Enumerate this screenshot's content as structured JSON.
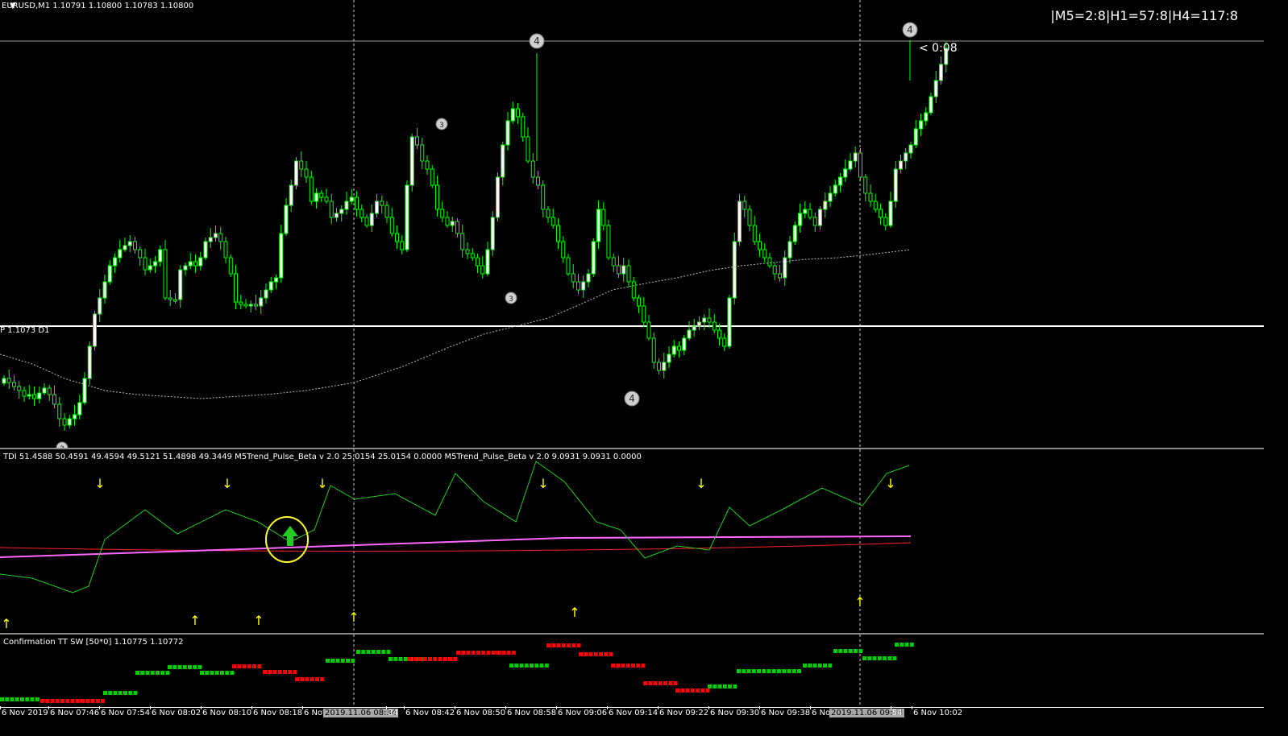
{
  "main": {
    "title": "EURUSD,M1  1.10791 1.10800 1.10783 1.10800",
    "corner_info": "|M5=2:8|H1=57:8|H4=117:8",
    "timer": "< 0:08",
    "pivot_label": "P 1.1073 D1",
    "wave_labels": [
      "4",
      "4",
      "4",
      "3",
      "3",
      "3"
    ]
  },
  "tdi": {
    "title": "TDI 51.4588 50.4591 49.4594 49.5121 51.4898 49.3449  M5Trend_Pulse_Beta v 2.0 25.0154 25.0154 0.0000  M5Trend_Pulse_Beta v 2.0 9.0931 9.0931 0.0000"
  },
  "confirmation": {
    "title": "Confirmation TT SW [50*0] 1.10775 1.10772"
  },
  "xaxis": {
    "ticks": [
      "6 Nov 2019",
      "6 Nov 07:46",
      "6 Nov 07:54",
      "6 Nov 08:02",
      "6 Nov 08:10",
      "6 Nov 08:18",
      "6 Nov",
      "34",
      "6 Nov 08:42",
      "6 Nov 08:50",
      "6 Nov 08:58",
      "6 Nov 09:06",
      "6 Nov 09:14",
      "6 Nov 09:22",
      "6 Nov 09:30",
      "6 Nov 09:38",
      "6 Nov",
      "54",
      "6 Nov 10:02"
    ],
    "highlight_1": "2019.11.06 08:34",
    "highlight_2": "2019.11.06 09:54"
  },
  "colors": {
    "background": "#000000",
    "bull_candle": "#ffffff",
    "bear_candle": "#00ff00",
    "tdi_line": "#22cc22",
    "pink_line": "#ff66ff",
    "red_line": "#ff2222",
    "arrow_yellow": "#ffff00",
    "conf_green": "#00cc00",
    "conf_red": "#ff0000"
  },
  "chart_data": [
    {
      "type": "candlestick",
      "title": "EURUSD,M1  1.10791 1.10800 1.10783 1.10800",
      "x_ticks": [
        "6 Nov 2019",
        "6 Nov 07:46",
        "6 Nov 07:54",
        "6 Nov 08:02",
        "6 Nov 08:10",
        "6 Nov 08:18",
        "6 Nov 08:34",
        "6 Nov 08:42",
        "6 Nov 08:50",
        "6 Nov 08:58",
        "6 Nov 09:06",
        "6 Nov 09:14",
        "6 Nov 09:22",
        "6 Nov 09:30",
        "6 Nov 09:38",
        "6 Nov 09:54",
        "6 Nov 10:02"
      ],
      "last_ohlc": {
        "open": 1.10791,
        "high": 1.108,
        "low": 1.10783,
        "close": 1.108
      },
      "pivot": 1.1073
    }
  ]
}
